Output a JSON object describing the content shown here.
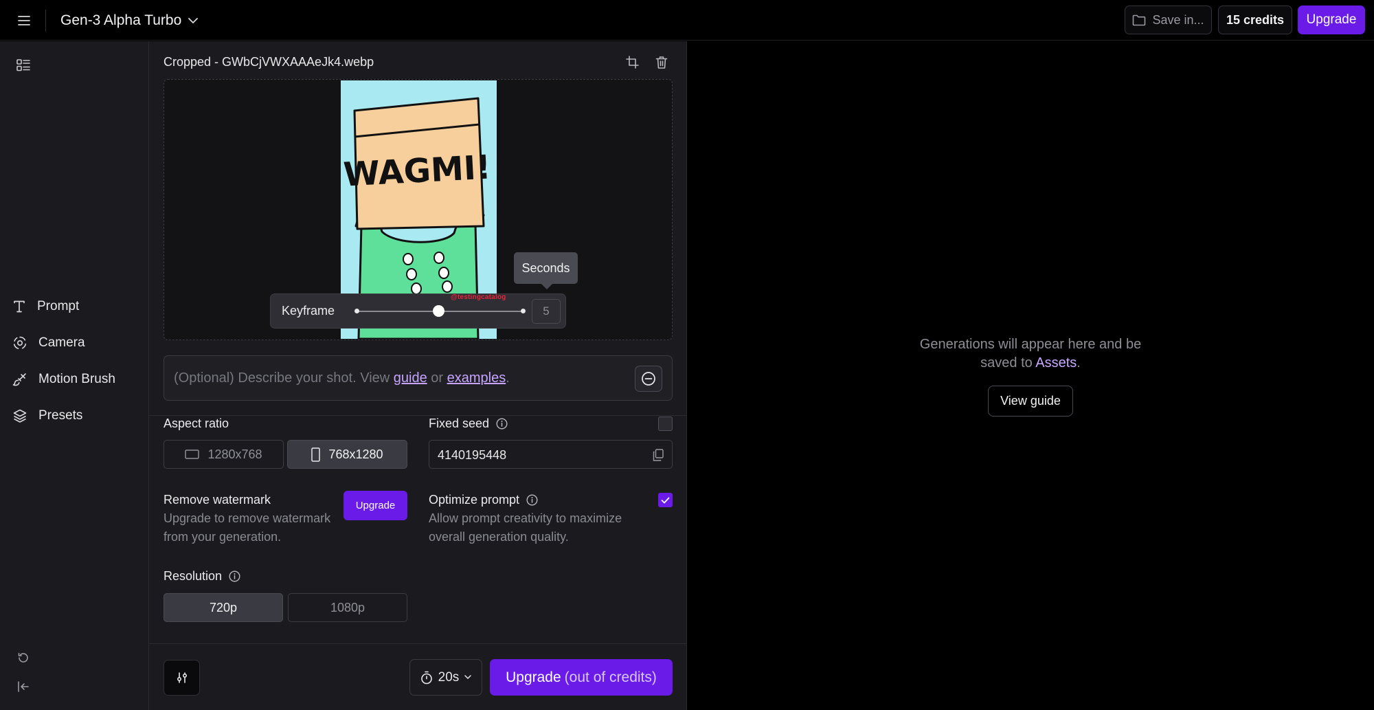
{
  "topbar": {
    "model_name": "Gen-3 Alpha Turbo",
    "save_label": "Save in...",
    "credits_label": "15 credits",
    "upgrade_label": "Upgrade"
  },
  "sidebar": {
    "items": [
      {
        "label": "Prompt",
        "icon": "text-t-icon"
      },
      {
        "label": "Camera",
        "icon": "camera-orbit-icon"
      },
      {
        "label": "Motion Brush",
        "icon": "brush-icon"
      },
      {
        "label": "Presets",
        "icon": "layers-icon"
      }
    ]
  },
  "panel": {
    "file_name": "Cropped - GWbCjVWXAAAeJk4.webp",
    "image": {
      "sign_text": "WAGMI!",
      "watermark": "@testingcatalog"
    },
    "keyframe": {
      "label": "Keyframe",
      "tooltip": "Seconds",
      "value": "5",
      "position_fraction": 0.49
    },
    "prompt": {
      "placeholder_prefix": "(Optional) Describe your shot. View ",
      "guide_link": "guide",
      "or_text": " or ",
      "examples_link": "examples",
      "suffix": "."
    },
    "aspect_ratio": {
      "label": "Aspect ratio",
      "options": [
        "1280x768",
        "768x1280"
      ],
      "selected": "768x1280"
    },
    "fixed_seed": {
      "label": "Fixed seed",
      "value": "4140195448",
      "checked": false
    },
    "remove_watermark": {
      "label": "Remove watermark",
      "description_line1": "Upgrade to remove watermark",
      "description_line2": "from your generation.",
      "button_label": "Upgrade"
    },
    "optimize_prompt": {
      "label": "Optimize prompt",
      "description_line1": "Allow prompt creativity to maximize",
      "description_line2": "overall generation quality.",
      "checked": true
    },
    "resolution": {
      "label": "Resolution",
      "options": [
        "720p",
        "1080p"
      ],
      "selected": "720p"
    },
    "footer": {
      "duration": "20s",
      "generate_bold": "Upgrade",
      "generate_muted": "(out of credits)"
    }
  },
  "right": {
    "message_line1": "Generations will appear here and be",
    "message_line2_prefix": "saved to ",
    "assets_link": "Assets",
    "message_suffix": ".",
    "guide_button": "View guide"
  },
  "colors": {
    "accent": "#6a1be8",
    "link": "#c6a4ff",
    "panel_bg": "#1b1b1f"
  }
}
